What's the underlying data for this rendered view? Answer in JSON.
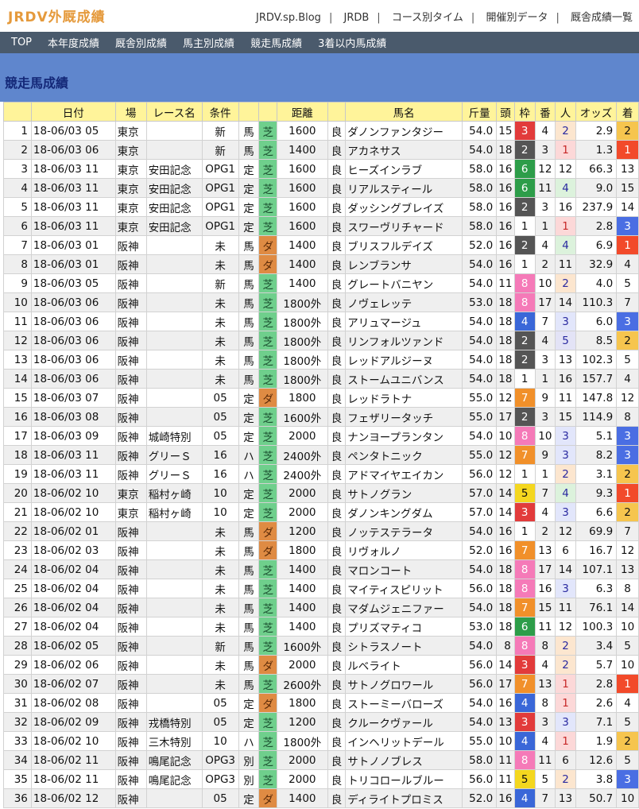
{
  "header": {
    "logo": "JRDV外厩成績",
    "links": [
      "JRDV.sp.Blog",
      "JRDB",
      "コース別タイム",
      "開催別データ",
      "厩舎成績一覧"
    ]
  },
  "nav": [
    "TOP",
    "本年度成績",
    "厩舎別成績",
    "馬主別成績",
    "競走馬成績",
    "3着以内馬成績"
  ],
  "page_title": "競走馬成績",
  "table": {
    "headers": [
      "",
      "日付",
      "場",
      "レース名",
      "条件",
      "",
      "",
      "距離",
      "",
      "馬名",
      "斤量",
      "頭",
      "枠",
      "番",
      "人",
      "オッズ",
      "着"
    ],
    "rows": [
      [
        "1",
        "18-06/03 05",
        "東京",
        "",
        "新",
        "馬",
        "芝",
        "1600",
        "良",
        "ダノンファンタジー",
        "54.0",
        "15",
        "3",
        "4",
        "2",
        "2.9",
        "2"
      ],
      [
        "2",
        "18-06/03 06",
        "東京",
        "",
        "新",
        "馬",
        "芝",
        "1400",
        "良",
        "アカネサス",
        "54.0",
        "18",
        "2",
        "3",
        "1",
        "1.3",
        "1"
      ],
      [
        "3",
        "18-06/03 11",
        "東京",
        "安田記念",
        "OPG1",
        "定",
        "芝",
        "1600",
        "良",
        "ヒーズインラブ",
        "58.0",
        "16",
        "6",
        "12",
        "12",
        "66.3",
        "13"
      ],
      [
        "4",
        "18-06/03 11",
        "東京",
        "安田記念",
        "OPG1",
        "定",
        "芝",
        "1600",
        "良",
        "リアルスティール",
        "58.0",
        "16",
        "6",
        "11",
        "4",
        "9.0",
        "15"
      ],
      [
        "5",
        "18-06/03 11",
        "東京",
        "安田記念",
        "OPG1",
        "定",
        "芝",
        "1600",
        "良",
        "ダッシングブレイズ",
        "58.0",
        "16",
        "2",
        "3",
        "16",
        "237.9",
        "14"
      ],
      [
        "6",
        "18-06/03 11",
        "東京",
        "安田記念",
        "OPG1",
        "定",
        "芝",
        "1600",
        "良",
        "スワーヴリチャード",
        "58.0",
        "16",
        "1",
        "1",
        "1",
        "2.8",
        "3"
      ],
      [
        "7",
        "18-06/03 01",
        "阪神",
        "",
        "未",
        "馬",
        "ダ",
        "1400",
        "良",
        "ブリスフルデイズ",
        "52.0",
        "16",
        "2",
        "4",
        "4",
        "6.9",
        "1"
      ],
      [
        "8",
        "18-06/03 01",
        "阪神",
        "",
        "未",
        "馬",
        "ダ",
        "1400",
        "良",
        "レンブランサ",
        "54.0",
        "16",
        "1",
        "2",
        "11",
        "32.9",
        "4"
      ],
      [
        "9",
        "18-06/03 05",
        "阪神",
        "",
        "新",
        "馬",
        "芝",
        "1400",
        "良",
        "グレートバニヤン",
        "54.0",
        "11",
        "8",
        "10",
        "2",
        "4.0",
        "5"
      ],
      [
        "10",
        "18-06/03 06",
        "阪神",
        "",
        "未",
        "馬",
        "芝",
        "1800外",
        "良",
        "ノヴェレッテ",
        "53.0",
        "18",
        "8",
        "17",
        "14",
        "110.3",
        "7"
      ],
      [
        "11",
        "18-06/03 06",
        "阪神",
        "",
        "未",
        "馬",
        "芝",
        "1800外",
        "良",
        "アリュマージュ",
        "54.0",
        "18",
        "4",
        "7",
        "3",
        "6.0",
        "3"
      ],
      [
        "12",
        "18-06/03 06",
        "阪神",
        "",
        "未",
        "馬",
        "芝",
        "1800外",
        "良",
        "リンフォルツァンド",
        "54.0",
        "18",
        "2",
        "4",
        "5",
        "8.5",
        "2"
      ],
      [
        "13",
        "18-06/03 06",
        "阪神",
        "",
        "未",
        "馬",
        "芝",
        "1800外",
        "良",
        "レッドアルジーヌ",
        "54.0",
        "18",
        "2",
        "3",
        "13",
        "102.3",
        "5"
      ],
      [
        "14",
        "18-06/03 06",
        "阪神",
        "",
        "未",
        "馬",
        "芝",
        "1800外",
        "良",
        "ストームユニバンス",
        "54.0",
        "18",
        "1",
        "1",
        "16",
        "157.7",
        "4"
      ],
      [
        "15",
        "18-06/03 07",
        "阪神",
        "",
        "05",
        "定",
        "ダ",
        "1800",
        "良",
        "レッドラトナ",
        "55.0",
        "12",
        "7",
        "9",
        "11",
        "147.8",
        "12"
      ],
      [
        "16",
        "18-06/03 08",
        "阪神",
        "",
        "05",
        "定",
        "芝",
        "1600外",
        "良",
        "フェザリータッチ",
        "55.0",
        "17",
        "2",
        "3",
        "15",
        "114.9",
        "8"
      ],
      [
        "17",
        "18-06/03 09",
        "阪神",
        "城崎特別",
        "05",
        "定",
        "芝",
        "2000",
        "良",
        "ナンヨープランタン",
        "54.0",
        "10",
        "8",
        "10",
        "3",
        "5.1",
        "3"
      ],
      [
        "18",
        "18-06/03 11",
        "阪神",
        "グリーＳ",
        "16",
        "ハ",
        "芝",
        "2400外",
        "良",
        "ペンタトニック",
        "55.0",
        "12",
        "7",
        "9",
        "3",
        "8.2",
        "3"
      ],
      [
        "19",
        "18-06/03 11",
        "阪神",
        "グリーＳ",
        "16",
        "ハ",
        "芝",
        "2400外",
        "良",
        "アドマイヤエイカン",
        "56.0",
        "12",
        "1",
        "1",
        "2",
        "3.1",
        "2"
      ],
      [
        "20",
        "18-06/02 10",
        "東京",
        "稲村ヶ崎",
        "10",
        "定",
        "芝",
        "2000",
        "良",
        "サトノグラン",
        "57.0",
        "14",
        "5",
        "7",
        "4",
        "9.3",
        "1"
      ],
      [
        "21",
        "18-06/02 10",
        "東京",
        "稲村ヶ崎",
        "10",
        "定",
        "芝",
        "2000",
        "良",
        "ダノンキングダム",
        "57.0",
        "14",
        "3",
        "4",
        "3",
        "6.6",
        "2"
      ],
      [
        "22",
        "18-06/02 01",
        "阪神",
        "",
        "未",
        "馬",
        "ダ",
        "1200",
        "良",
        "ノッテステラータ",
        "54.0",
        "16",
        "1",
        "2",
        "12",
        "69.9",
        "7"
      ],
      [
        "23",
        "18-06/02 03",
        "阪神",
        "",
        "未",
        "馬",
        "ダ",
        "1800",
        "良",
        "リヴォルノ",
        "52.0",
        "16",
        "7",
        "13",
        "6",
        "16.7",
        "12"
      ],
      [
        "24",
        "18-06/02 04",
        "阪神",
        "",
        "未",
        "馬",
        "芝",
        "1400",
        "良",
        "マロンコート",
        "54.0",
        "18",
        "8",
        "17",
        "14",
        "107.1",
        "13"
      ],
      [
        "25",
        "18-06/02 04",
        "阪神",
        "",
        "未",
        "馬",
        "芝",
        "1400",
        "良",
        "マイティスピリット",
        "56.0",
        "18",
        "8",
        "16",
        "3",
        "6.3",
        "8"
      ],
      [
        "26",
        "18-06/02 04",
        "阪神",
        "",
        "未",
        "馬",
        "芝",
        "1400",
        "良",
        "マダムジェニファー",
        "54.0",
        "18",
        "7",
        "15",
        "11",
        "76.1",
        "14"
      ],
      [
        "27",
        "18-06/02 04",
        "阪神",
        "",
        "未",
        "馬",
        "芝",
        "1400",
        "良",
        "プリズマティコ",
        "53.0",
        "18",
        "6",
        "11",
        "12",
        "100.3",
        "10"
      ],
      [
        "28",
        "18-06/02 05",
        "阪神",
        "",
        "新",
        "馬",
        "芝",
        "1600外",
        "良",
        "シトラスノート",
        "54.0",
        "8",
        "8",
        "8",
        "2",
        "3.4",
        "5"
      ],
      [
        "29",
        "18-06/02 06",
        "阪神",
        "",
        "未",
        "馬",
        "ダ",
        "2000",
        "良",
        "ルベライト",
        "56.0",
        "14",
        "3",
        "4",
        "2",
        "5.7",
        "10"
      ],
      [
        "30",
        "18-06/02 07",
        "阪神",
        "",
        "未",
        "馬",
        "芝",
        "2600外",
        "良",
        "サトノグロワール",
        "56.0",
        "17",
        "7",
        "13",
        "1",
        "2.8",
        "1"
      ],
      [
        "31",
        "18-06/02 08",
        "阪神",
        "",
        "05",
        "定",
        "ダ",
        "1800",
        "良",
        "ストーミーバローズ",
        "54.0",
        "16",
        "4",
        "8",
        "1",
        "2.6",
        "4"
      ],
      [
        "32",
        "18-06/02 09",
        "阪神",
        "戎橋特別",
        "05",
        "定",
        "芝",
        "1200",
        "良",
        "クルークヴァール",
        "54.0",
        "13",
        "3",
        "3",
        "3",
        "7.1",
        "5"
      ],
      [
        "33",
        "18-06/02 10",
        "阪神",
        "三木特別",
        "10",
        "ハ",
        "芝",
        "1800外",
        "良",
        "インヘリットデール",
        "55.0",
        "10",
        "4",
        "4",
        "1",
        "1.9",
        "2"
      ],
      [
        "34",
        "18-06/02 11",
        "阪神",
        "鳴尾記念",
        "OPG3",
        "別",
        "芝",
        "2000",
        "良",
        "サトノノブレス",
        "58.0",
        "11",
        "8",
        "11",
        "6",
        "12.6",
        "5"
      ],
      [
        "35",
        "18-06/02 11",
        "阪神",
        "鳴尾記念",
        "OPG3",
        "別",
        "芝",
        "2000",
        "良",
        "トリコロールブルー",
        "56.0",
        "11",
        "5",
        "5",
        "2",
        "3.8",
        "3"
      ],
      [
        "36",
        "18-06/02 12",
        "阪神",
        "",
        "05",
        "定",
        "ダ",
        "1400",
        "良",
        "ディライトプロミス",
        "52.0",
        "16",
        "4",
        "7",
        "13",
        "50.7",
        "10"
      ]
    ]
  }
}
